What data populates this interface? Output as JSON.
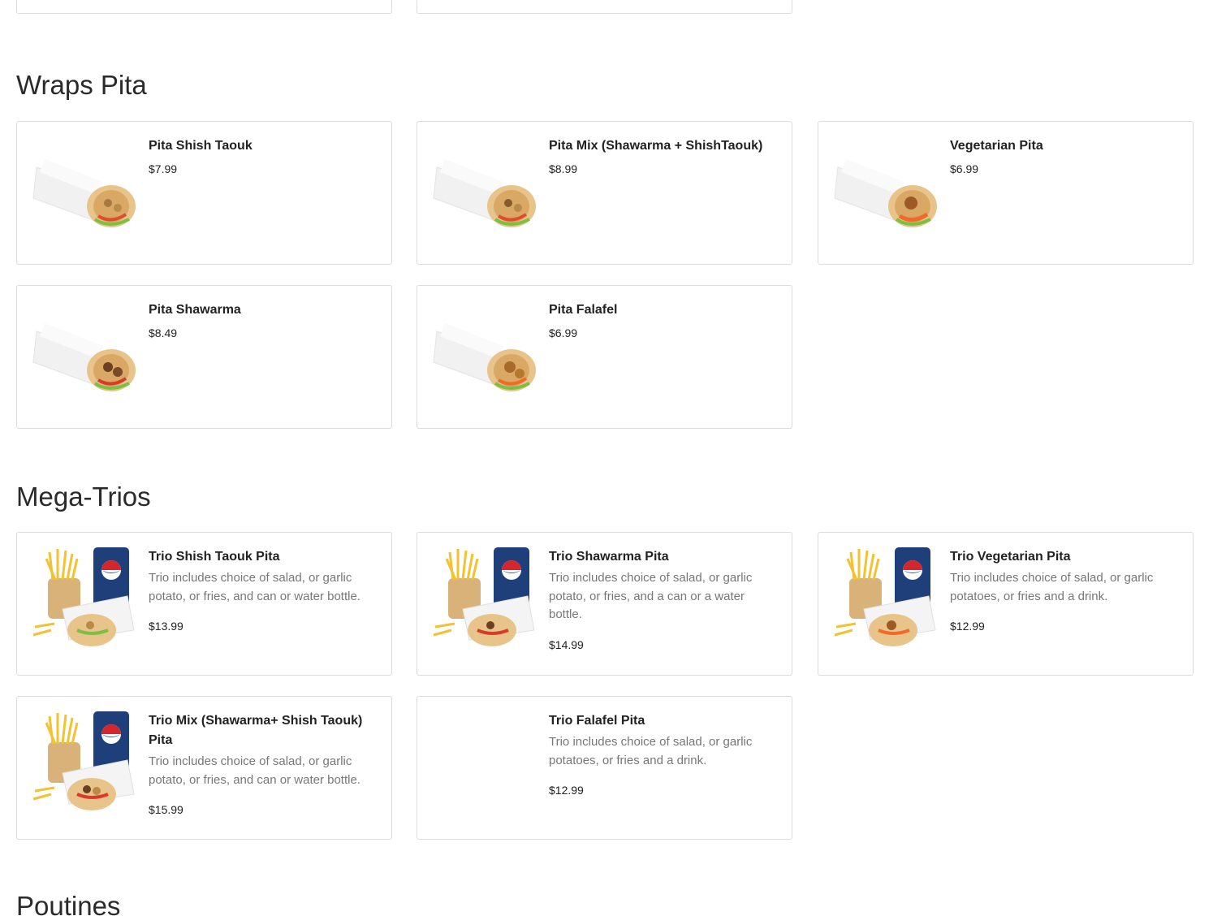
{
  "sections": [
    {
      "title": "Wraps Pita",
      "items": [
        {
          "name": "Pita Shish Taouk",
          "price": "$7.99",
          "image": "chicken-wrap-image"
        },
        {
          "name": "Pita Mix (Shawarma + ShishTaouk)",
          "price": "$8.99",
          "image": "mix-wrap-image"
        },
        {
          "name": "Vegetarian Pita",
          "price": "$6.99",
          "image": "vegetarian-wrap-image"
        },
        {
          "name": "Pita Shawarma",
          "price": "$8.49",
          "image": "beef-wrap-image"
        },
        {
          "name": "Pita Falafel",
          "price": "$6.99",
          "image": "falafel-wrap-image"
        }
      ]
    },
    {
      "title": "Mega-Trios",
      "items": [
        {
          "name": "Trio Shish Taouk Pita",
          "description": "Trio includes choice of salad, or garlic potato, or fries, and can or water bottle.",
          "price": "$13.99",
          "image": "trio-combo-image"
        },
        {
          "name": "Trio Shawarma Pita",
          "description": "Trio includes choice of salad, or garlic potato, or fries, and a can or a water bottle.",
          "price": "$14.99",
          "image": "trio-combo-image"
        },
        {
          "name": "Trio Vegetarian Pita",
          "description": "Trio includes choice of salad, or garlic potatoes, or fries and a drink.",
          "price": "$12.99",
          "image": "trio-combo-image"
        },
        {
          "name": "Trio Mix (Shawarma+ Shish Taouk) Pita",
          "description": "Trio includes choice of salad, or garlic potato, or fries, and can or water bottle.",
          "price": "$15.99",
          "image": "trio-combo-image"
        },
        {
          "name": "Trio Falafel Pita",
          "description": "Trio includes choice of salad, or garlic potatoes, or fries and a drink.",
          "price": "$12.99"
        }
      ]
    },
    {
      "title": "Poutines"
    }
  ],
  "colors": {
    "card_border": "#dcdcdc",
    "title_text": "#222222",
    "description_text": "#777777",
    "pita_bread": "#e8c48a",
    "wrap_paper": "#f4f4f4",
    "can_blue": "#1f3f7a",
    "fries": "#f2c233"
  }
}
